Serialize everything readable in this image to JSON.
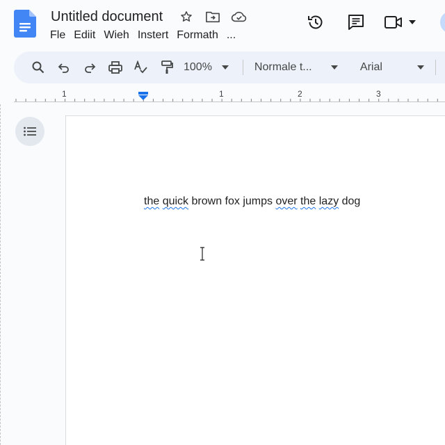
{
  "document": {
    "title": "Untitled document"
  },
  "menu": {
    "items": [
      "Fle",
      "Ediit",
      "Wieh",
      "Instert",
      "Formath",
      "..."
    ]
  },
  "toolbar": {
    "zoom_value": "100%",
    "paragraph_style": "Normale t...",
    "font_family_value": "Arial"
  },
  "ruler": {
    "labels": [
      "1",
      "1",
      "2",
      "3"
    ]
  },
  "page": {
    "words": [
      {
        "text": "the",
        "misspelled": true
      },
      {
        "text": " ",
        "misspelled": false
      },
      {
        "text": "quick",
        "misspelled": true
      },
      {
        "text": " brown fox jumps ",
        "misspelled": false
      },
      {
        "text": "over",
        "misspelled": true
      },
      {
        "text": " ",
        "misspelled": false
      },
      {
        "text": "the",
        "misspelled": true
      },
      {
        "text": " ",
        "misspelled": false
      },
      {
        "text": "lazy",
        "misspelled": true
      },
      {
        "text": " dog",
        "misspelled": false
      }
    ]
  },
  "colors": {
    "accent": "#1a73e8",
    "docs_brand": "#4285f4",
    "toolbar_bg": "#edf2fa",
    "background": "#f9fbfd"
  },
  "icons": {
    "logo": "google-docs-logo",
    "title": [
      "star-icon",
      "move-to-folder-icon",
      "cloud-saved-icon"
    ],
    "header": [
      "version-history-icon",
      "comments-icon",
      "meet-video-icon"
    ],
    "toolbar": [
      "search-icon",
      "undo-icon",
      "redo-icon",
      "print-icon",
      "spellcheck-icon",
      "paint-format-icon"
    ],
    "side": [
      "outline-icon"
    ]
  }
}
